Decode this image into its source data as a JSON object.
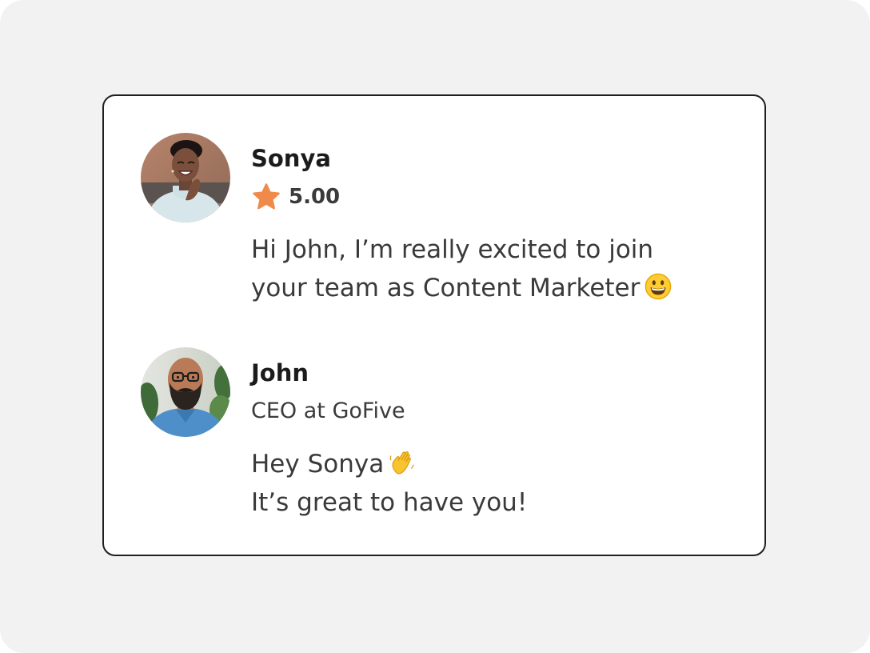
{
  "colors": {
    "background": "#f2f2f2",
    "card": "#ffffff",
    "card_border": "#1f1f1f",
    "star": "#f08a4b",
    "name_text": "#1b1b1b",
    "body_text": "#3a3a3a"
  },
  "messages": [
    {
      "avatar_icon": "avatar-photo-sonya",
      "name": "Sonya",
      "rating_icon": "star-icon",
      "rating": "5.00",
      "lines": [
        "Hi John, I’m really excited to join",
        "your team as Content Marketer"
      ],
      "emoji_icon": "grinning-face-emoji-icon"
    },
    {
      "avatar_icon": "avatar-photo-john",
      "name": "John",
      "subtitle": "CEO at GoFive",
      "lines": [
        "Hey Sonya",
        "It’s great to have you!"
      ],
      "emoji_icon": "waving-hand-emoji-icon"
    }
  ]
}
